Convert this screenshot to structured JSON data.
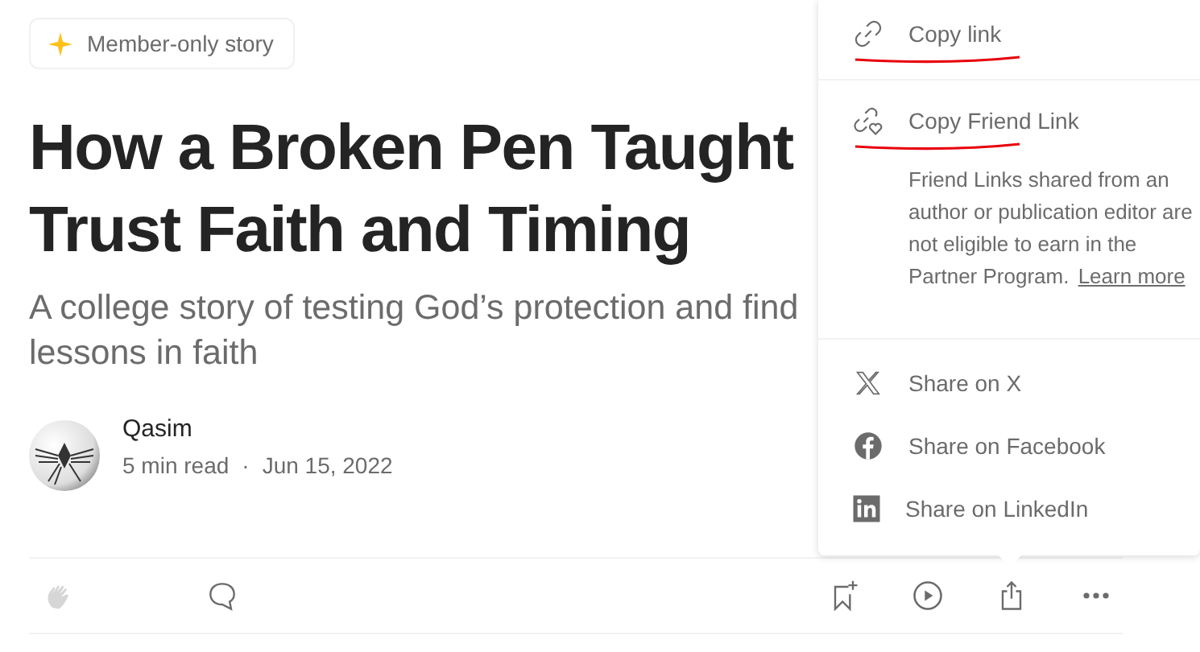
{
  "badge": {
    "label": "Member-only story"
  },
  "title_lines": [
    "How a Broken Pen Taught",
    "Trust Faith and Timing"
  ],
  "subtitle_lines": [
    "A college story of testing God’s protection and find",
    "lessons in faith"
  ],
  "author": {
    "name": "Qasim",
    "read_time": "5 min read",
    "separator": "·",
    "date": "Jun 15, 2022"
  },
  "actions": [
    {
      "kind": "clap",
      "disabled": true
    },
    {
      "kind": "comment",
      "disabled": false
    },
    {
      "kind": "bookmark",
      "disabled": false
    },
    {
      "kind": "play",
      "disabled": false
    },
    {
      "kind": "share",
      "disabled": false
    },
    {
      "kind": "more",
      "disabled": false
    }
  ],
  "share_menu": {
    "copy_items": [
      {
        "kind": "link",
        "label": "Copy link",
        "underlined": true
      },
      {
        "kind": "friend",
        "label": "Copy Friend Link",
        "underlined": true,
        "note": "Friend Links shared from an author or publication editor are not eligible to earn in the Partner Program.",
        "note_link": "Learn more"
      }
    ],
    "share_items": [
      {
        "kind": "x",
        "label": "Share on X"
      },
      {
        "kind": "facebook",
        "label": "Share on Facebook"
      },
      {
        "kind": "linkedin",
        "label": "Share on LinkedIn"
      }
    ]
  }
}
